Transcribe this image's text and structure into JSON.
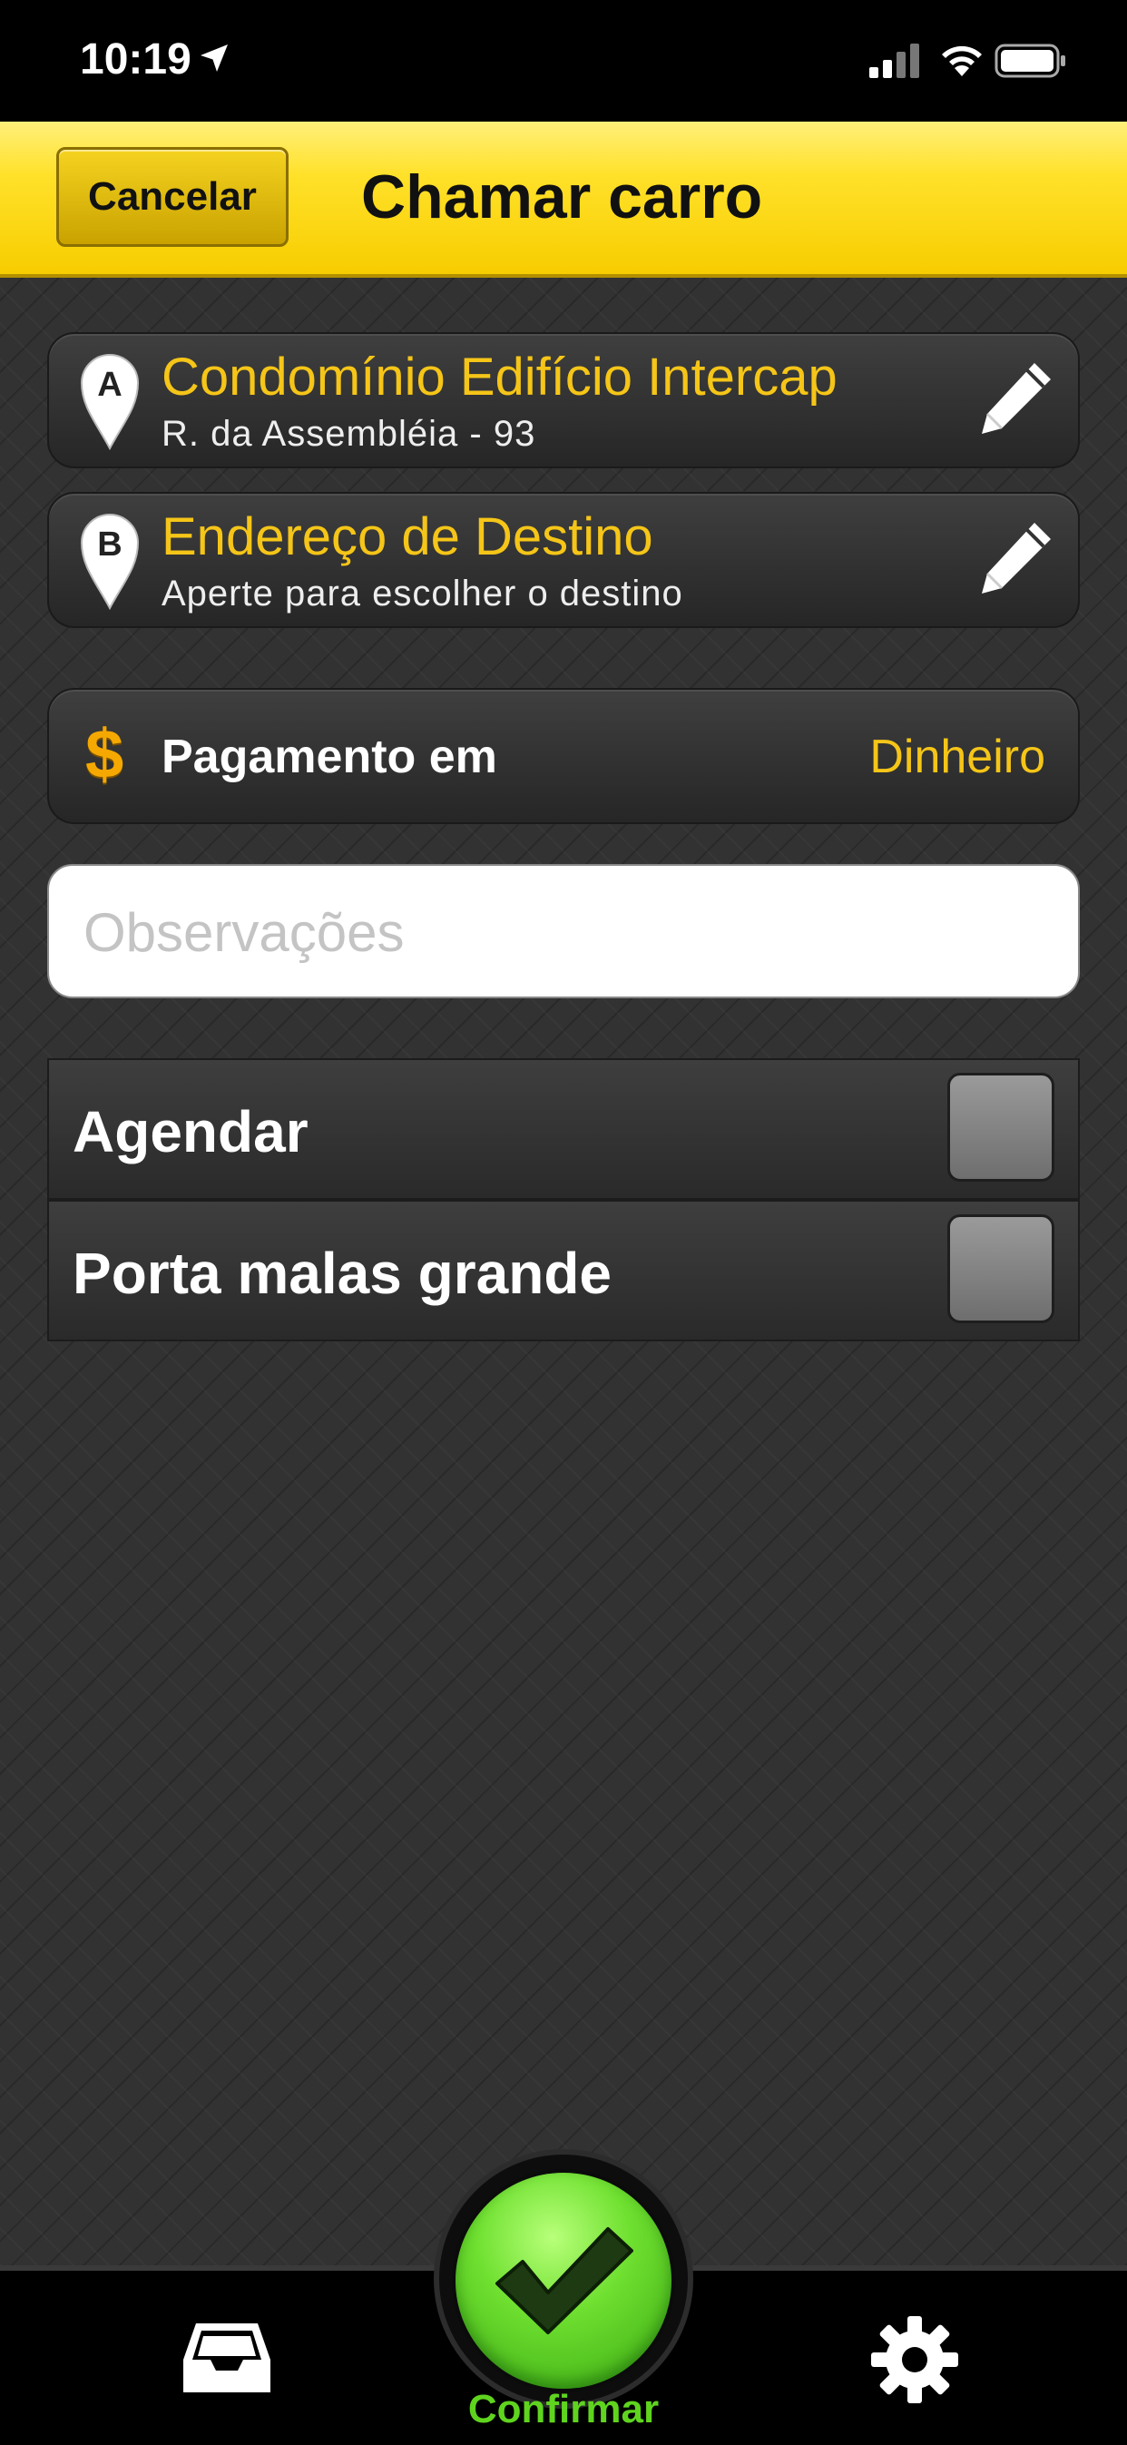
{
  "status_bar": {
    "time": "10:19"
  },
  "navbar": {
    "cancel_label": "Cancelar",
    "title": "Chamar carro"
  },
  "origin": {
    "pin_letter": "A",
    "title": "Condomínio Edifício Intercap",
    "subtitle": "R. da Assembléia - 93"
  },
  "destination": {
    "pin_letter": "B",
    "title": "Endereço de Destino",
    "subtitle": "Aperte para escolher o destino"
  },
  "payment": {
    "icon_symbol": "$",
    "label": "Pagamento em",
    "value": "Dinheiro"
  },
  "observations": {
    "placeholder": "Observações",
    "value": ""
  },
  "options": [
    {
      "label": "Agendar",
      "checked": false
    },
    {
      "label": "Porta malas grande",
      "checked": false
    }
  ],
  "tabbar": {
    "confirm_label": "Confirmar",
    "left_icon": "inbox-icon",
    "right_icon": "gear-icon"
  },
  "colors": {
    "accent_yellow": "#f5c518",
    "confirm_green": "#5fd41e",
    "navbar_yellow": "#ffe12a"
  }
}
